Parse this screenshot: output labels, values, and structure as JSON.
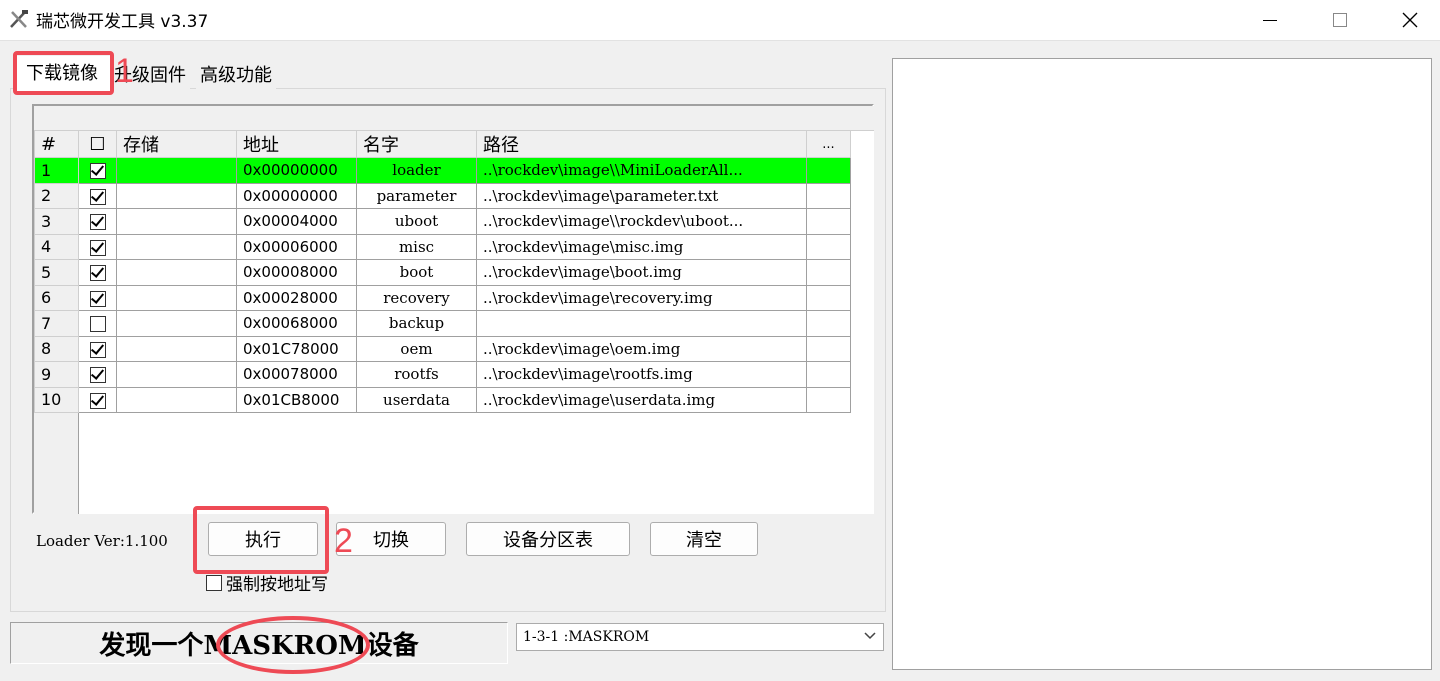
{
  "window": {
    "title": "瑞芯微开发工具 v3.37",
    "minimize_glyph": "—",
    "maximize_glyph": "☐",
    "close_glyph": "✕"
  },
  "tabs": [
    "下载镜像",
    "升级固件",
    "高级功能"
  ],
  "table": {
    "columns": [
      "#",
      "☐",
      "存储",
      "地址",
      "名字",
      "路径",
      "..."
    ],
    "rows": [
      {
        "num": "1",
        "checked": true,
        "storage": "",
        "address": "0x00000000",
        "name": "loader",
        "path": "..\\rockdev\\image\\\\MiniLoaderAll...",
        "selected": true
      },
      {
        "num": "2",
        "checked": true,
        "storage": "",
        "address": "0x00000000",
        "name": "parameter",
        "path": "..\\rockdev\\image\\parameter.txt",
        "selected": false
      },
      {
        "num": "3",
        "checked": true,
        "storage": "",
        "address": "0x00004000",
        "name": "uboot",
        "path": "..\\rockdev\\image\\\\rockdev\\uboot...",
        "selected": false
      },
      {
        "num": "4",
        "checked": true,
        "storage": "",
        "address": "0x00006000",
        "name": "misc",
        "path": "..\\rockdev\\image\\misc.img",
        "selected": false
      },
      {
        "num": "5",
        "checked": true,
        "storage": "",
        "address": "0x00008000",
        "name": "boot",
        "path": "..\\rockdev\\image\\boot.img",
        "selected": false
      },
      {
        "num": "6",
        "checked": true,
        "storage": "",
        "address": "0x00028000",
        "name": "recovery",
        "path": "..\\rockdev\\image\\recovery.img",
        "selected": false
      },
      {
        "num": "7",
        "checked": false,
        "storage": "",
        "address": "0x00068000",
        "name": "backup",
        "path": "",
        "selected": false
      },
      {
        "num": "8",
        "checked": true,
        "storage": "",
        "address": "0x01C78000",
        "name": "oem",
        "path": "..\\rockdev\\image\\oem.img",
        "selected": false
      },
      {
        "num": "9",
        "checked": true,
        "storage": "",
        "address": "0x00078000",
        "name": "rootfs",
        "path": "..\\rockdev\\image\\rootfs.img",
        "selected": false
      },
      {
        "num": "10",
        "checked": true,
        "storage": "",
        "address": "0x01CB8000",
        "name": "userdata",
        "path": "..\\rockdev\\image\\userdata.img",
        "selected": false
      }
    ],
    "selected_color": "#00ff00"
  },
  "loader_version": "Loader Ver:1.100",
  "buttons": {
    "run": "执行",
    "switch": "切换",
    "partition_table": "设备分区表",
    "clear": "清空"
  },
  "force_address": {
    "label": "强制按地址写",
    "checked": false
  },
  "status_text": "发现一个MASKROM设备",
  "device_select": {
    "value": "1-3-1 :MASKROM"
  },
  "annotations": {
    "mark1": "1",
    "mark2": "2",
    "color": "#ee4a55"
  }
}
